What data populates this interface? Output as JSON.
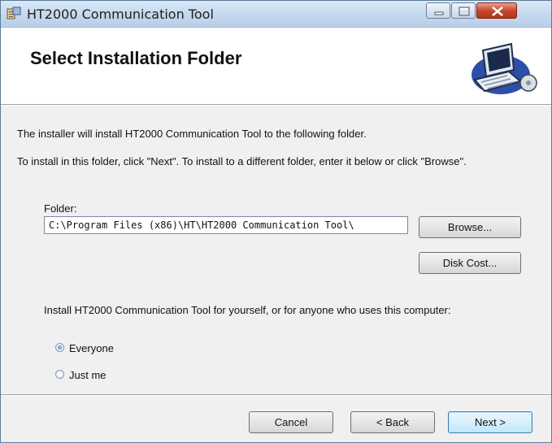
{
  "window": {
    "title": "HT2000 Communication Tool"
  },
  "header": {
    "title": "Select Installation Folder"
  },
  "body": {
    "line1": "The installer will install HT2000 Communication Tool to the following folder.",
    "line2": "To install in this folder, click \"Next\". To install to a different folder, enter it below or click \"Browse\".",
    "folder_label": "Folder:",
    "folder_value": "C:\\Program Files (x86)\\HT\\HT2000 Communication Tool\\",
    "browse_label": "Browse...",
    "disk_cost_label": "Disk Cost...",
    "install_for_text": "Install HT2000 Communication Tool for yourself, or for anyone who uses this computer:",
    "options": [
      {
        "label": "Everyone",
        "selected": true
      },
      {
        "label": "Just me",
        "selected": false
      }
    ]
  },
  "footer": {
    "cancel_label": "Cancel",
    "back_label": "< Back",
    "next_label": "Next >"
  },
  "icons": {
    "title": "installer-icon",
    "header": "computer-install-icon",
    "minimize": "minimize-icon",
    "maximize": "maximize-icon",
    "close": "close-icon"
  },
  "colors": {
    "close_button": "#c9462c",
    "default_button_border": "#3c7fb1",
    "radio_fill": "#2d75c8"
  }
}
